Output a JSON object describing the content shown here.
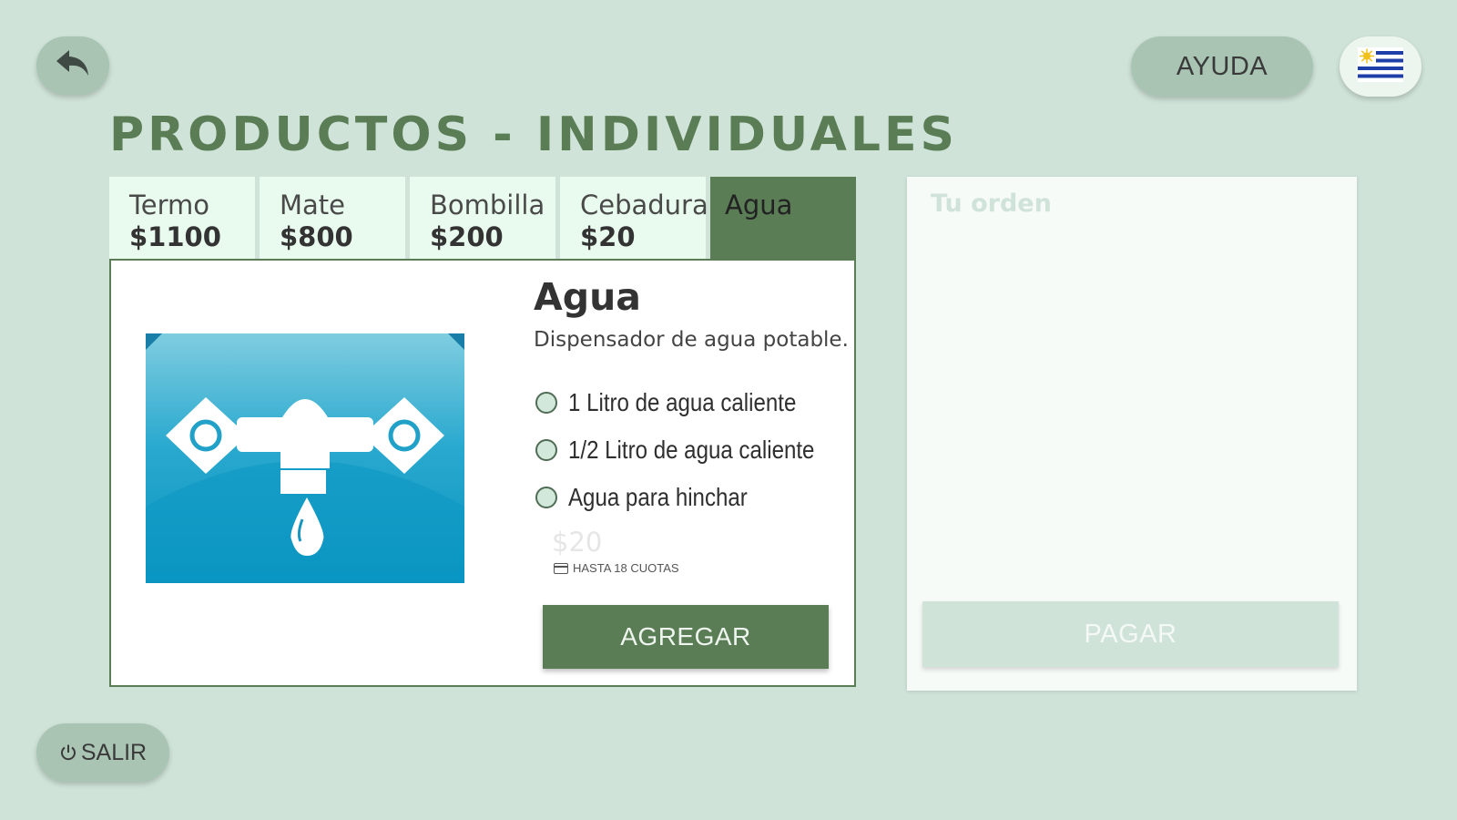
{
  "header": {
    "back_icon": "reply-arrow-icon",
    "help_label": "AYUDA",
    "flag_icon": "uruguay-flag-icon"
  },
  "page": {
    "title": "PRODUCTOS - INDIVIDUALES"
  },
  "tabs": [
    {
      "label": "Termo",
      "price": "$1100",
      "active": false
    },
    {
      "label": "Mate",
      "price": "$800",
      "active": false
    },
    {
      "label": "Bombilla",
      "price": "$200",
      "active": false
    },
    {
      "label": "Cebadura",
      "price": "$20",
      "active": false
    },
    {
      "label": "Agua",
      "price": "",
      "active": true
    }
  ],
  "product": {
    "name": "Agua",
    "description": "Dispensador de agua potable.",
    "image_icon": "water-faucet-icon",
    "options": [
      {
        "label": "1 Litro de agua caliente",
        "selected": false
      },
      {
        "label": "1/2 Litro de agua caliente",
        "selected": false
      },
      {
        "label": "Agua para hinchar",
        "selected": false
      }
    ],
    "price": "$20",
    "installments": "HASTA 18 CUOTAS",
    "add_label": "AGREGAR"
  },
  "order": {
    "title": "Tu orden",
    "pay_label": "PAGAR"
  },
  "footer": {
    "exit_label": "SALIR",
    "exit_icon": "power-icon"
  },
  "colors": {
    "background": "#cfe3d8",
    "accent": "#5a7d55",
    "tab_bg": "#e8fbee",
    "pill_button": "#a9c4b3"
  }
}
